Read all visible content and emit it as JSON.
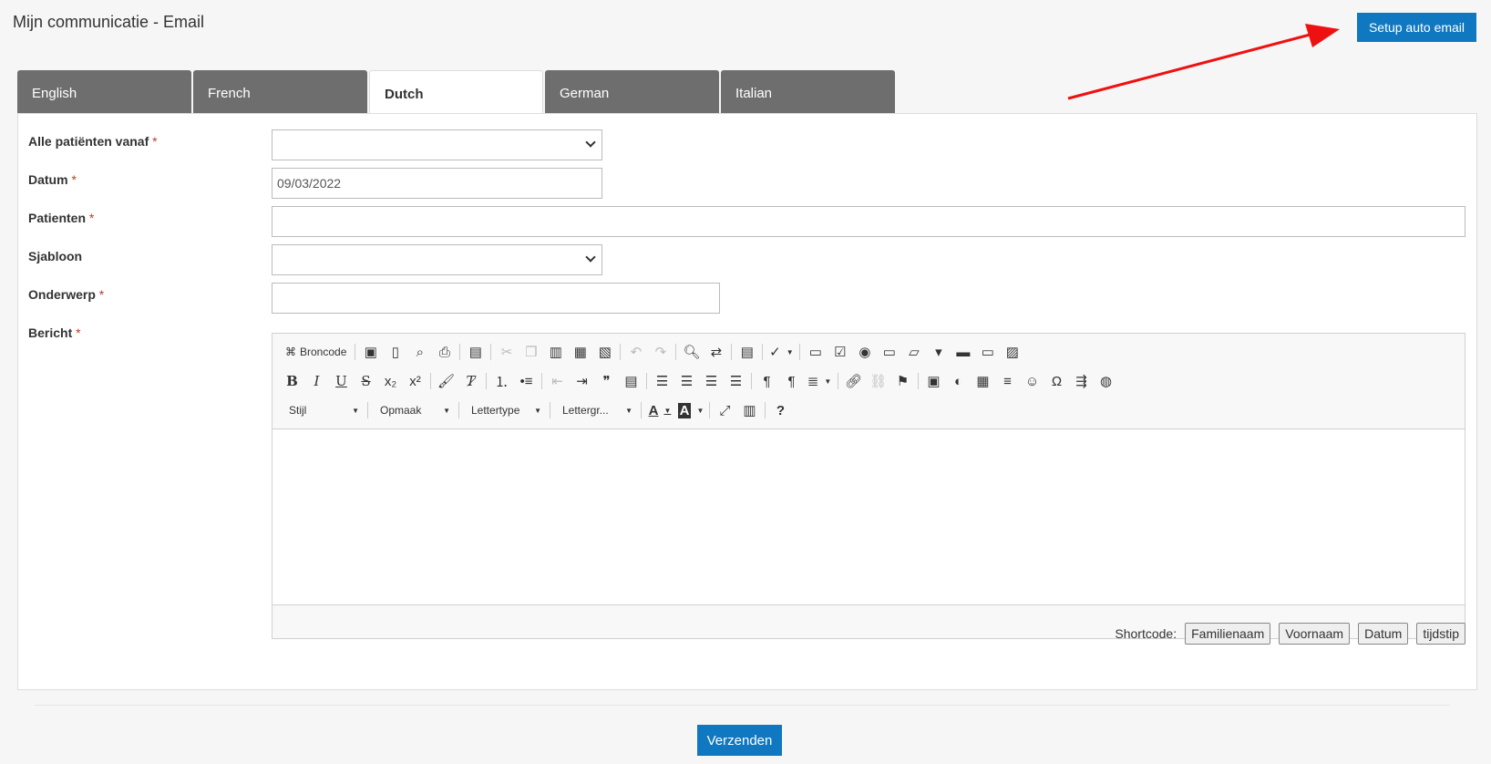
{
  "page": {
    "title": "Mijn communicatie - Email"
  },
  "header": {
    "setup_button": "Setup auto email"
  },
  "tabs": [
    {
      "label": "English",
      "active": false
    },
    {
      "label": "French",
      "active": false
    },
    {
      "label": "Dutch",
      "active": true
    },
    {
      "label": "German",
      "active": false
    },
    {
      "label": "Italian",
      "active": false
    }
  ],
  "form": {
    "required_mark": "*",
    "patients_from": {
      "label": "Alle patiënten vanaf",
      "value": ""
    },
    "date": {
      "label": "Datum",
      "value": "09/03/2022"
    },
    "patients": {
      "label": "Patienten",
      "value": ""
    },
    "template": {
      "label": "Sjabloon",
      "value": ""
    },
    "subject": {
      "label": "Onderwerp",
      "value": ""
    },
    "message": {
      "label": "Bericht"
    }
  },
  "editor": {
    "source_label": "Broncode",
    "style_label": "Stijl",
    "format_label": "Opmaak",
    "font_label": "Lettertype",
    "size_label": "Lettergr...",
    "icons": {
      "bold": "B",
      "italic": "I",
      "underline": "U",
      "strike": "S",
      "subscript": "x₂",
      "superscript": "x²",
      "numbered": "⒈",
      "bulleted": "•≡",
      "quote": "❞",
      "help": "?",
      "text_color": "A",
      "bg_color": "A",
      "special_char": "Ω",
      "smiley": "☺",
      "maximize": "⤢"
    }
  },
  "shortcodes": {
    "label": "Shortcode:",
    "buttons": [
      "Familienaam",
      "Voornaam",
      "Datum",
      "tijdstip"
    ]
  },
  "footer": {
    "submit_button": "Verzenden"
  },
  "colors": {
    "primary": "#0f78c0",
    "tab_inactive": "#6e6e6e",
    "arrow": "#ee1111"
  }
}
